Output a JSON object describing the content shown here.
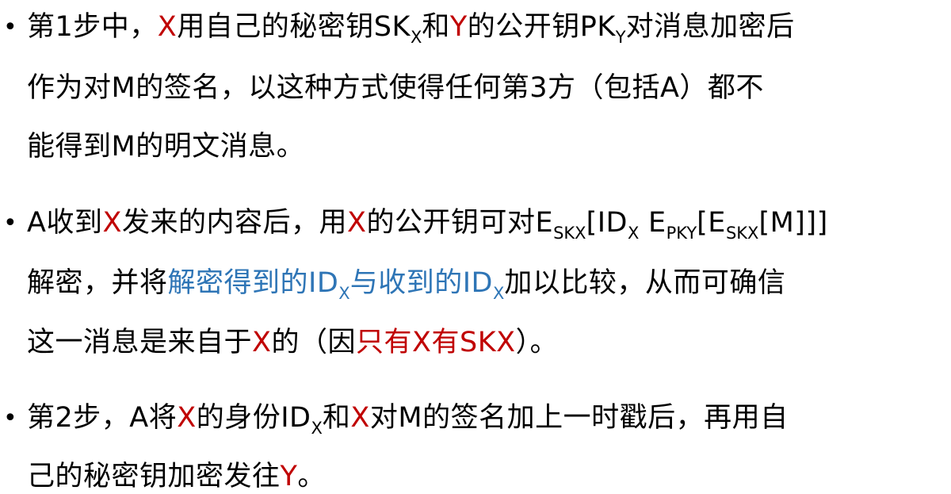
{
  "bullet_symbol": "•",
  "colors": {
    "text": "#000000",
    "red": "#c00000",
    "blue": "#2e75b6"
  },
  "bullets": [
    {
      "lines": [
        {
          "segments": [
            {
              "text": "第1步中，",
              "style": "normal"
            },
            {
              "text": "X",
              "style": "red"
            },
            {
              "text": "用自己的秘密钥SK",
              "style": "normal"
            },
            {
              "text": "X",
              "style": "sub"
            },
            {
              "text": "和",
              "style": "normal"
            },
            {
              "text": "Y",
              "style": "red"
            },
            {
              "text": "的公开钥PK",
              "style": "normal"
            },
            {
              "text": "Y",
              "style": "sub"
            },
            {
              "text": "对消息加密后",
              "style": "normal"
            }
          ]
        },
        {
          "segments": [
            {
              "text": "作为对M的签名，以这种方式使得任何第3方（包括A）都不",
              "style": "normal"
            }
          ]
        },
        {
          "segments": [
            {
              "text": "能得到M的明文消息。",
              "style": "normal"
            }
          ]
        }
      ]
    },
    {
      "lines": [
        {
          "segments": [
            {
              "text": "A收到",
              "style": "normal"
            },
            {
              "text": "X",
              "style": "red"
            },
            {
              "text": "发来的内容后，用",
              "style": "normal"
            },
            {
              "text": "X",
              "style": "red"
            },
            {
              "text": "的公开钥可对E",
              "style": "normal"
            },
            {
              "text": "SKX",
              "style": "sub"
            },
            {
              "text": "[ID",
              "style": "normal"
            },
            {
              "text": "X",
              "style": "sub"
            },
            {
              "text": "  E",
              "style": "normal"
            },
            {
              "text": "PKY",
              "style": "sub"
            },
            {
              "text": "[E",
              "style": "normal"
            },
            {
              "text": "SKX",
              "style": "sub"
            },
            {
              "text": "[M]]]",
              "style": "normal"
            }
          ]
        },
        {
          "segments": [
            {
              "text": "解密，并将",
              "style": "normal"
            },
            {
              "text": "解密得到的ID",
              "style": "blue"
            },
            {
              "text": "X",
              "style": "sub-blue"
            },
            {
              "text": "与收到的ID",
              "style": "blue"
            },
            {
              "text": "X",
              "style": "sub-blue"
            },
            {
              "text": "加以比较，从而可确信",
              "style": "normal"
            }
          ]
        },
        {
          "segments": [
            {
              "text": "这一消息是来自于",
              "style": "normal"
            },
            {
              "text": "X",
              "style": "red"
            },
            {
              "text": "的（因",
              "style": "normal"
            },
            {
              "text": "只有X有SKX",
              "style": "red"
            },
            {
              "text": "）。",
              "style": "normal"
            }
          ]
        }
      ]
    },
    {
      "lines": [
        {
          "segments": [
            {
              "text": "第2步，A将",
              "style": "normal"
            },
            {
              "text": "X",
              "style": "red"
            },
            {
              "text": "的身份ID",
              "style": "normal"
            },
            {
              "text": "X",
              "style": "sub"
            },
            {
              "text": "和",
              "style": "normal"
            },
            {
              "text": "X",
              "style": "red"
            },
            {
              "text": "对M的签名加上一时戳后，再用自",
              "style": "normal"
            }
          ]
        },
        {
          "segments": [
            {
              "text": "己的秘密钥加密发往",
              "style": "normal"
            },
            {
              "text": "Y",
              "style": "red"
            },
            {
              "text": "。",
              "style": "normal"
            }
          ]
        }
      ]
    }
  ]
}
